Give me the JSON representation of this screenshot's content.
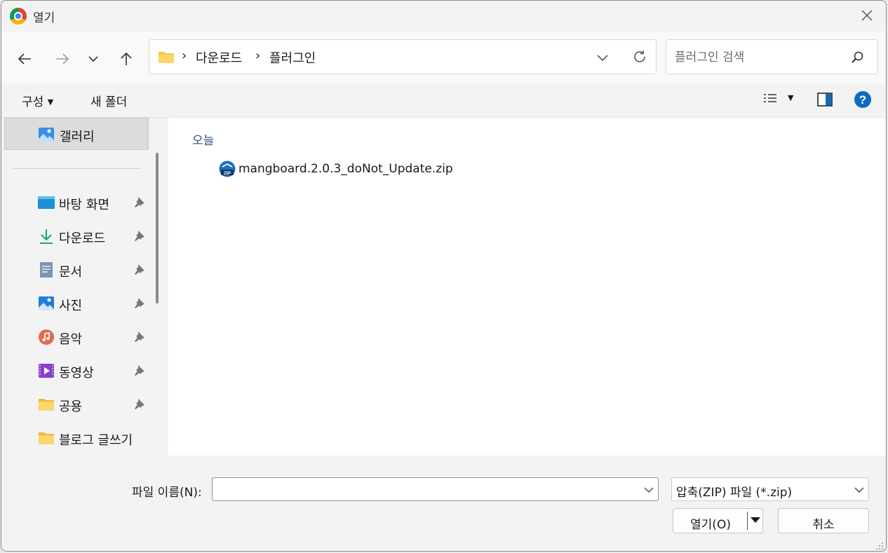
{
  "window": {
    "title": "열기"
  },
  "nav": {
    "breadcrumb": [
      "다운로드",
      "플러그인"
    ],
    "search_placeholder": "플러그인 검색"
  },
  "toolbar": {
    "organize_label": "구성",
    "new_folder_label": "새 폴더"
  },
  "sidebar": {
    "gallery_label": "갤러리",
    "items": [
      {
        "label": "바탕 화면",
        "icon": "desktop-icon",
        "pinned": true
      },
      {
        "label": "다운로드",
        "icon": "download-icon",
        "pinned": true
      },
      {
        "label": "문서",
        "icon": "document-icon",
        "pinned": true
      },
      {
        "label": "사진",
        "icon": "pictures-icon",
        "pinned": true
      },
      {
        "label": "음악",
        "icon": "music-icon",
        "pinned": true
      },
      {
        "label": "동영상",
        "icon": "video-icon",
        "pinned": true
      },
      {
        "label": "공용",
        "icon": "folder-icon",
        "pinned": true
      },
      {
        "label": "블로그 글쓰기",
        "icon": "folder-icon",
        "pinned": false
      }
    ]
  },
  "main": {
    "group_header": "오늘",
    "files": [
      {
        "name": "mangboard.2.0.3_doNot_Update.zip",
        "icon": "zip-file-icon"
      }
    ]
  },
  "footer": {
    "filename_label": "파일 이름(N):",
    "filename_value": "",
    "filter_value": "압축(ZIP) 파일 (*.zip)",
    "open_label": "열기(O)",
    "cancel_label": "취소"
  },
  "colors": {
    "accent": "#0067c0",
    "folder": "#f8c34a",
    "help": "#0f6cbd"
  }
}
